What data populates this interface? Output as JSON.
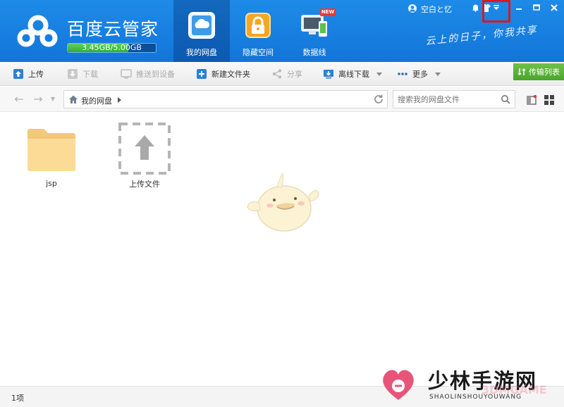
{
  "colors": {
    "header": "#1275d8",
    "accent_green": "#4aa52b",
    "highlight_red": "#d9191f",
    "watermark_pink": "#e8557a"
  },
  "header": {
    "brand_title": "百度云管家",
    "quota_text": "3.45GB/5.00GB",
    "quota_fraction": 0.69,
    "slogan": "云上的日子，你我共享",
    "username": "空白と忆",
    "tabs": [
      {
        "label": "我的网盘",
        "icon": "cloud-drive-icon",
        "active": true
      },
      {
        "label": "隐藏空间",
        "icon": "lock-icon",
        "active": false
      },
      {
        "label": "数据线",
        "icon": "monitor-phone-icon",
        "active": false,
        "badge": "NEW"
      }
    ],
    "window_icons": [
      "bell-icon",
      "shirt-icon",
      "menu-arrow-icon",
      "minimize-icon",
      "maximize-icon",
      "close-icon"
    ]
  },
  "toolbar": {
    "upload": "上传",
    "download": "下载",
    "push_device": "推送到设备",
    "new_folder": "新建文件夹",
    "share": "分享",
    "offline_download": "离线下载",
    "more": "更多",
    "transfer_list": "传输列表"
  },
  "address": {
    "crumb": "我的网盘",
    "search_placeholder": "搜索我的网盘文件"
  },
  "files": [
    {
      "label": "jsp",
      "type": "folder"
    },
    {
      "label": "上传文件",
      "type": "upload"
    }
  ],
  "status": {
    "count": "1项"
  },
  "watermark": {
    "title": "少林手游网",
    "subtitle": "SHAOLINSHOUYOUWANG",
    "ghost": "3DMGAME"
  }
}
